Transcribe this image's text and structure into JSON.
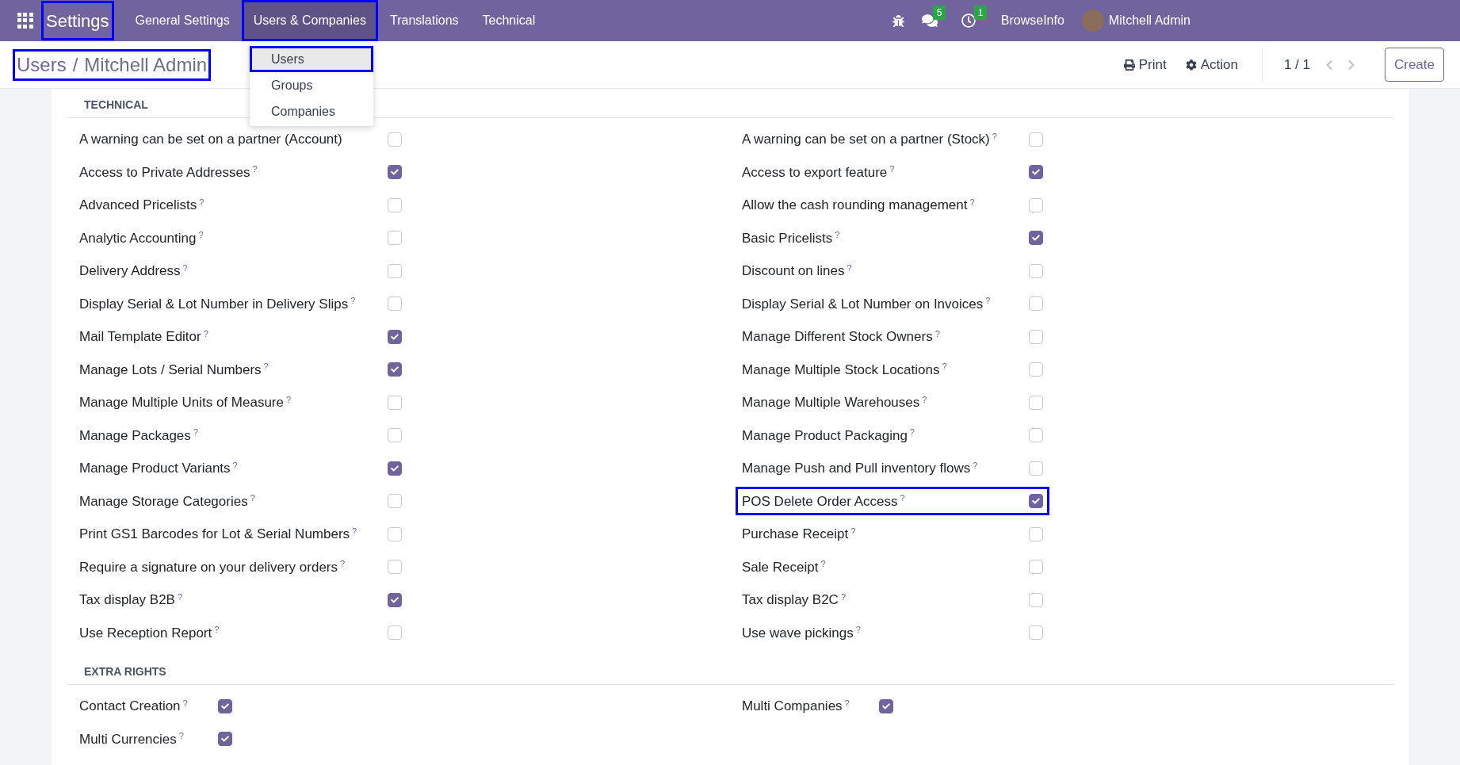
{
  "navbar": {
    "brand": "Settings",
    "brand_highlighted": true,
    "menus": [
      {
        "label": "General Settings",
        "selected": false,
        "highlighted": false
      },
      {
        "label": "Users & Companies",
        "selected": true,
        "highlighted": true
      },
      {
        "label": "Translations",
        "selected": false,
        "highlighted": false
      },
      {
        "label": "Technical",
        "selected": false,
        "highlighted": false
      }
    ],
    "messages_badge": "5",
    "activities_badge": "1",
    "company": "BrowseInfo",
    "user": "Mitchell Admin"
  },
  "dropdown": [
    {
      "label": "Users",
      "selected": true,
      "highlighted": true
    },
    {
      "label": "Groups",
      "selected": false,
      "highlighted": false
    },
    {
      "label": "Companies",
      "selected": false,
      "highlighted": false
    }
  ],
  "breadcrumb": {
    "parent": "Users",
    "separator": "/",
    "current": "Mitchell Admin",
    "highlighted": true
  },
  "toolbar": {
    "print": "Print",
    "action": "Action",
    "pager": "1 / 1",
    "create": "Create"
  },
  "sections": [
    {
      "title": "TECHNICAL",
      "kind": "wide",
      "items": [
        {
          "label": "A warning can be set on a partner (Account)",
          "checked": false,
          "highlighted": false
        },
        {
          "label": "A warning can be set on a partner (Stock)",
          "help": "?",
          "checked": false,
          "highlighted": false
        },
        {
          "label": "Access to Private Addresses",
          "help": "?",
          "checked": true,
          "highlighted": false
        },
        {
          "label": "Access to export feature",
          "help": "?",
          "checked": true,
          "highlighted": false
        },
        {
          "label": "Advanced Pricelists",
          "help": "?",
          "checked": false,
          "highlighted": false
        },
        {
          "label": "Allow the cash rounding management",
          "help": "?",
          "checked": false,
          "highlighted": false
        },
        {
          "label": "Analytic Accounting",
          "help": "?",
          "checked": false,
          "highlighted": false
        },
        {
          "label": "Basic Pricelists",
          "help": "?",
          "checked": true,
          "highlighted": false
        },
        {
          "label": "Delivery Address",
          "help": "?",
          "checked": false,
          "highlighted": false
        },
        {
          "label": "Discount on lines",
          "help": "?",
          "checked": false,
          "highlighted": false
        },
        {
          "label": "Display Serial & Lot Number in Delivery Slips",
          "help": "?",
          "checked": false,
          "highlighted": false
        },
        {
          "label": "Display Serial & Lot Number on Invoices",
          "help": "?",
          "checked": false,
          "highlighted": false
        },
        {
          "label": "Mail Template Editor",
          "help": "?",
          "checked": true,
          "highlighted": false
        },
        {
          "label": "Manage Different Stock Owners",
          "help": "?",
          "checked": false,
          "highlighted": false
        },
        {
          "label": "Manage Lots / Serial Numbers",
          "help": "?",
          "checked": true,
          "highlighted": false
        },
        {
          "label": "Manage Multiple Stock Locations",
          "help": "?",
          "checked": false,
          "highlighted": false
        },
        {
          "label": "Manage Multiple Units of Measure",
          "help": "?",
          "checked": false,
          "highlighted": false
        },
        {
          "label": "Manage Multiple Warehouses",
          "help": "?",
          "checked": false,
          "highlighted": false
        },
        {
          "label": "Manage Packages",
          "help": "?",
          "checked": false,
          "highlighted": false
        },
        {
          "label": "Manage Product Packaging",
          "help": "?",
          "checked": false,
          "highlighted": false
        },
        {
          "label": "Manage Product Variants",
          "help": "?",
          "checked": true,
          "highlighted": false
        },
        {
          "label": "Manage Push and Pull inventory flows",
          "help": "?",
          "checked": false,
          "highlighted": false
        },
        {
          "label": "Manage Storage Categories",
          "help": "?",
          "checked": false,
          "highlighted": false
        },
        {
          "label": "POS Delete Order Access",
          "help": "?",
          "checked": true,
          "highlighted": true
        },
        {
          "label": "Print GS1 Barcodes for Lot & Serial Numbers",
          "help": "?",
          "checked": false,
          "highlighted": false
        },
        {
          "label": "Purchase Receipt",
          "help": "?",
          "checked": false,
          "highlighted": false
        },
        {
          "label": "Require a signature on your delivery orders",
          "help": "?",
          "checked": false,
          "highlighted": false
        },
        {
          "label": "Sale Receipt",
          "help": "?",
          "checked": false,
          "highlighted": false
        },
        {
          "label": "Tax display B2B",
          "help": "?",
          "checked": true,
          "highlighted": false
        },
        {
          "label": "Tax display B2C",
          "help": "?",
          "checked": false,
          "highlighted": false
        },
        {
          "label": "Use Reception Report",
          "help": "?",
          "checked": false,
          "highlighted": false
        },
        {
          "label": "Use wave pickings",
          "help": "?",
          "checked": false,
          "highlighted": false
        }
      ]
    },
    {
      "title": "EXTRA RIGHTS",
      "kind": "narrow",
      "items": [
        {
          "label": "Contact Creation",
          "help": "?",
          "checked": true,
          "highlighted": false
        },
        {
          "label": "Multi Companies",
          "help": "?",
          "checked": true,
          "highlighted": false
        },
        {
          "label": "Multi Currencies",
          "help": "?",
          "checked": true,
          "highlighted": false
        }
      ]
    }
  ]
}
